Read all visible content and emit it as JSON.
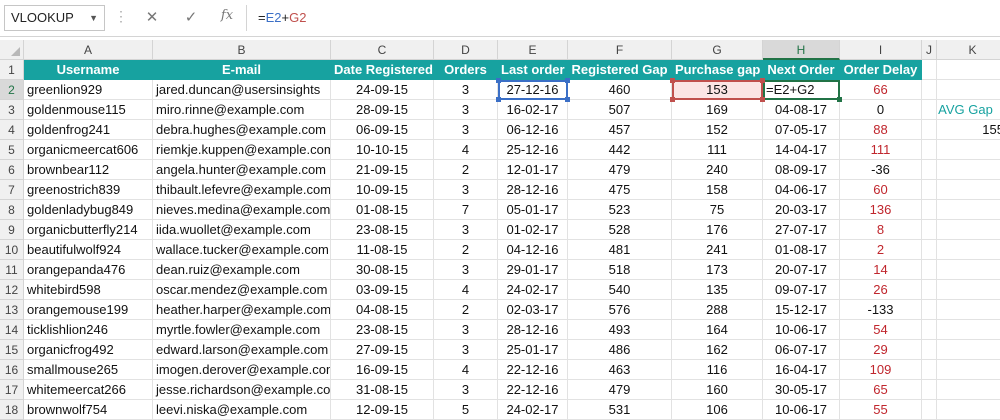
{
  "formula_bar": {
    "name_box": "VLOOKUP",
    "cancel_icon": "✕",
    "enter_icon": "✓",
    "fx_label": "fx",
    "formula_prefix": "=",
    "formula_ref1": "E2",
    "formula_op": "+",
    "formula_ref2": "G2"
  },
  "columns": [
    "A",
    "B",
    "C",
    "D",
    "E",
    "F",
    "G",
    "H",
    "I",
    "J",
    "K"
  ],
  "headers": [
    "Username",
    "E-mail",
    "Date Registered",
    "Orders",
    "Last order",
    "Registered Gap",
    "Purchase gap",
    "Next Order",
    "Order Delay"
  ],
  "rows": [
    [
      "greenlion929",
      "jared.duncan@usersinsights",
      "24-09-15",
      "3",
      "27-12-16",
      "460",
      "153",
      "=E2+G2",
      "66"
    ],
    [
      "goldenmouse115",
      "miro.rinne@example.com",
      "28-09-15",
      "3",
      "16-02-17",
      "507",
      "169",
      "04-08-17",
      "0"
    ],
    [
      "goldenfrog241",
      "debra.hughes@example.com",
      "06-09-15",
      "3",
      "06-12-16",
      "457",
      "152",
      "07-05-17",
      "88"
    ],
    [
      "organicmeercat606",
      "riemkje.kuppen@example.com",
      "10-10-15",
      "4",
      "25-12-16",
      "442",
      "111",
      "14-04-17",
      "111"
    ],
    [
      "brownbear112",
      "angela.hunter@example.com",
      "21-09-15",
      "2",
      "12-01-17",
      "479",
      "240",
      "08-09-17",
      "-36"
    ],
    [
      "greenostrich839",
      "thibault.lefevre@example.com",
      "10-09-15",
      "3",
      "28-12-16",
      "475",
      "158",
      "04-06-17",
      "60"
    ],
    [
      "goldenladybug849",
      "nieves.medina@example.com",
      "01-08-15",
      "7",
      "05-01-17",
      "523",
      "75",
      "20-03-17",
      "136"
    ],
    [
      "organicbutterfly214",
      "iida.wuollet@example.com",
      "23-08-15",
      "3",
      "01-02-17",
      "528",
      "176",
      "27-07-17",
      "8"
    ],
    [
      "beautifulwolf924",
      "wallace.tucker@example.com",
      "11-08-15",
      "2",
      "04-12-16",
      "481",
      "241",
      "01-08-17",
      "2"
    ],
    [
      "orangepanda476",
      "dean.ruiz@example.com",
      "30-08-15",
      "3",
      "29-01-17",
      "518",
      "173",
      "20-07-17",
      "14"
    ],
    [
      "whitebird598",
      "oscar.mendez@example.com",
      "03-09-15",
      "4",
      "24-02-17",
      "540",
      "135",
      "09-07-17",
      "26"
    ],
    [
      "orangemouse199",
      "heather.harper@example.com",
      "04-08-15",
      "2",
      "02-03-17",
      "576",
      "288",
      "15-12-17",
      "-133"
    ],
    [
      "ticklishlion246",
      "myrtle.fowler@example.com",
      "23-08-15",
      "3",
      "28-12-16",
      "493",
      "164",
      "10-06-17",
      "54"
    ],
    [
      "organicfrog492",
      "edward.larson@example.com",
      "27-09-15",
      "3",
      "25-01-17",
      "486",
      "162",
      "06-07-17",
      "29"
    ],
    [
      "smallmouse265",
      "imogen.derover@example.com",
      "16-09-15",
      "4",
      "22-12-16",
      "463",
      "116",
      "16-04-17",
      "109"
    ],
    [
      "whitemeercat266",
      "jesse.richardson@example.com",
      "31-08-15",
      "3",
      "22-12-16",
      "479",
      "160",
      "30-05-17",
      "65"
    ],
    [
      "brownwolf754",
      "leevi.niska@example.com",
      "12-09-15",
      "5",
      "24-02-17",
      "531",
      "106",
      "10-06-17",
      "55"
    ]
  ],
  "avg_gap_label": "AVG Gap",
  "avg_gap_value": "155",
  "colors": {
    "header_bg": "#17a2a0",
    "red_text": "#c0262d",
    "selection_green": "#217346"
  }
}
